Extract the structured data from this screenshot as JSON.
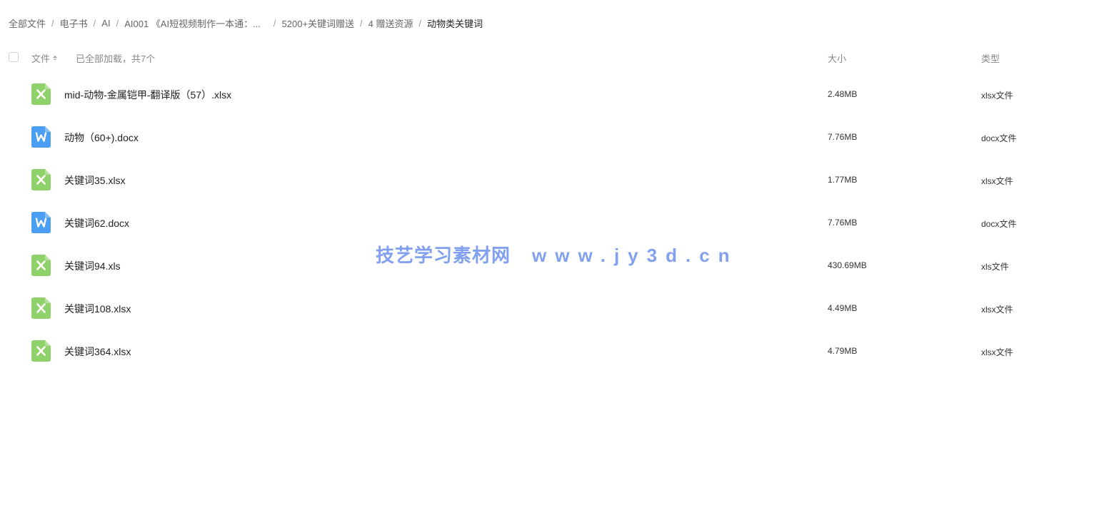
{
  "breadcrumb": {
    "items": [
      "全部文件",
      "电子书",
      "AI",
      "AI001 《AI短视频制作一本通：...",
      "5200+关键词赠送",
      "4 赠送资源",
      "动物类关键词"
    ],
    "separator": "/"
  },
  "header": {
    "name_label": "文件",
    "loaded_text": "已全部加载，共7个",
    "size_label": "大小",
    "type_label": "类型"
  },
  "files": [
    {
      "name": "mid-动物-金属铠甲-翻译版（57）.xlsx",
      "size": "2.48MB",
      "type": "xlsx文件",
      "icon": "excel-icon"
    },
    {
      "name": "动物（60+).docx",
      "size": "7.76MB",
      "type": "docx文件",
      "icon": "word-icon"
    },
    {
      "name": "关键词35.xlsx",
      "size": "1.77MB",
      "type": "xlsx文件",
      "icon": "excel-icon"
    },
    {
      "name": "关键词62.docx",
      "size": "7.76MB",
      "type": "docx文件",
      "icon": "word-icon"
    },
    {
      "name": "关键词94.xls",
      "size": "430.69MB",
      "type": "xls文件",
      "icon": "excel-icon"
    },
    {
      "name": "关键词108.xlsx",
      "size": "4.49MB",
      "type": "xlsx文件",
      "icon": "excel-icon"
    },
    {
      "name": "关键词364.xlsx",
      "size": "4.79MB",
      "type": "xlsx文件",
      "icon": "excel-icon"
    }
  ],
  "watermark": {
    "title": "技艺学习素材网",
    "url": "www.jy3d.cn"
  },
  "colors": {
    "excel": "#8fd16a",
    "word": "#4a9ff5",
    "watermark": "#7b9cf0"
  }
}
